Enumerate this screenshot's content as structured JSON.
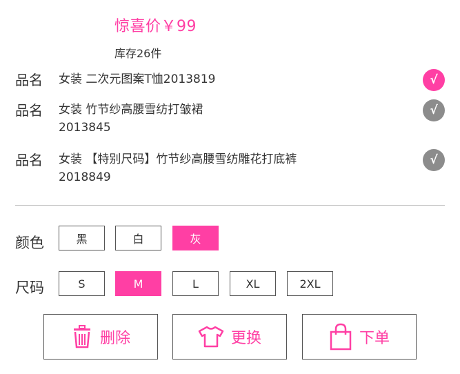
{
  "price_label": "惊喜价￥99",
  "stock_label": "库存26件",
  "products": [
    {
      "label": "品名",
      "name_line1": "女装 二次元图案T恤2013819",
      "name_line2": "",
      "checked": true,
      "check_glyph": "√"
    },
    {
      "label": "品名",
      "name_line1": "女装 竹节纱高腰雪纺打皱裙",
      "name_line2": "2013845",
      "checked": false,
      "check_glyph": "√"
    },
    {
      "label": "品名",
      "name_line1": "女装 【特别尺码】竹节纱高腰雪纺雕花打底裤",
      "name_line2": "2018849",
      "checked": false,
      "check_glyph": "√"
    }
  ],
  "color": {
    "label": "颜色",
    "options": [
      "黑",
      "白",
      "灰"
    ],
    "selected": "灰"
  },
  "size": {
    "label": "尺码",
    "options": [
      "S",
      "M",
      "L",
      "XL",
      "2XL"
    ],
    "selected": "M"
  },
  "actions": {
    "delete_label": "删除",
    "change_label": "更换",
    "order_label": "下单"
  },
  "colors": {
    "accent": "#ff3fa4",
    "muted_check": "#8c8c8c",
    "border": "#555555",
    "divider": "#bfbfbf"
  },
  "icons": {
    "delete": "trash-icon",
    "change": "tshirt-icon",
    "order": "shopping-bag-icon"
  }
}
